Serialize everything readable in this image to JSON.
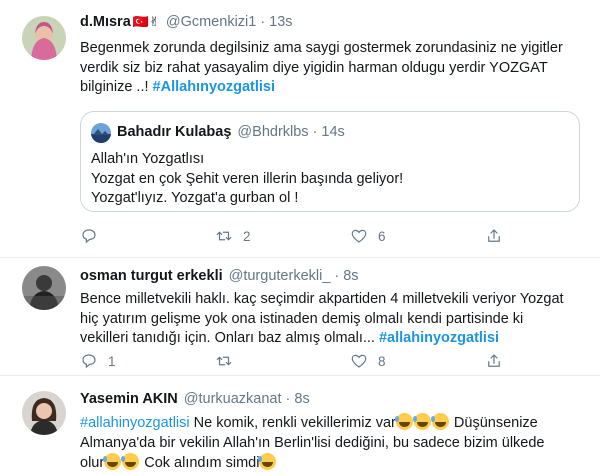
{
  "tweets": [
    {
      "name": "d.Mısra",
      "name_emoji": "🇹🇷✌",
      "handle": "@Gcmenkizi1",
      "time": "13s",
      "lines": [
        "Begenmek zorunda degilsiniz ama saygi gostermek zorundasiniz ne yigitler",
        "verdik siz biz rahat yasayalim diye yigidin harman oldugu yerdir YOZGAT",
        "bilginize ..!"
      ],
      "hashtag": "#Allahınyozgatlisi",
      "quote": {
        "name": "Bahadır Kulabaş",
        "handle": "@Bhdrklbs",
        "time": "14s",
        "lines": [
          "Allah'ın Yozgatlısı",
          "Yozgat en çok Şehit veren illerin başında geliyor!",
          "Yozgat'lıyız. Yozgat'a gurban ol !"
        ]
      },
      "reply_count": "",
      "retweet_count": "2",
      "like_count": "6"
    },
    {
      "name": "osman turgut erkekli",
      "handle": "@turguterkekli_",
      "time": "8s",
      "lines": [
        "Bence milletvekili haklı. kaç seçimdir akpartiden 4 milletvekili veriyor Yozgat",
        "hiç yatırım gelişme yok ona istinaden demiş olmalı kendi partisinde ki",
        "vekilleri tanıdığı için. Onları baz almış olmalı..."
      ],
      "hashtag": "#allahinyozgatlisi",
      "reply_count": "1",
      "retweet_count": "",
      "like_count": "8"
    },
    {
      "name": "Yasemin AKIN",
      "handle": "@turkuazkanat",
      "time": "8s",
      "hashtag": "#allahinyozgatlisi",
      "line1_after": "Ne komik, renkli vekillerimiz var",
      "line1_tail": "Düşünsenize",
      "line2": "Almanya'da bir vekilin Allah'ın Berlin'lisi dediğini, bu sadece bizim ülkede",
      "line3_a": "olur",
      "line3_b": "Cok alındım simdi"
    }
  ],
  "colors": {
    "accent": "#1b95e0",
    "muted": "#657786",
    "border": "#e6ecf0"
  }
}
